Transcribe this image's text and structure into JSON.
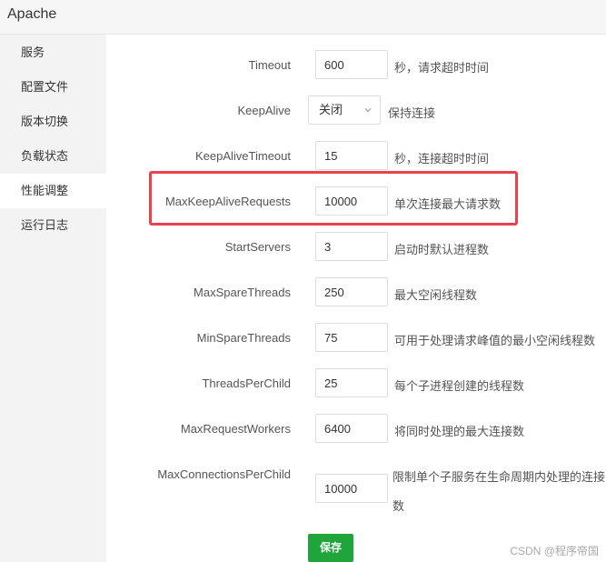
{
  "window": {
    "title": "Apache"
  },
  "sidebar": {
    "items": [
      {
        "label": "服务",
        "active": false
      },
      {
        "label": "配置文件",
        "active": false
      },
      {
        "label": "版本切换",
        "active": false
      },
      {
        "label": "负载状态",
        "active": false
      },
      {
        "label": "性能调整",
        "active": true
      },
      {
        "label": "运行日志",
        "active": false
      }
    ]
  },
  "settings": [
    {
      "label": "Timeout",
      "value": "600",
      "hint": "秒，请求超时时间"
    },
    {
      "label": "KeepAlive",
      "value": "关闭",
      "hint": "保持连接",
      "control": "select"
    },
    {
      "label": "KeepAliveTimeout",
      "value": "15",
      "hint": "秒，连接超时时间"
    },
    {
      "label": "MaxKeepAliveRequests",
      "value": "10000",
      "hint": "单次连接最大请求数",
      "highlighted": true
    },
    {
      "label": "StartServers",
      "value": "3",
      "hint": "启动时默认进程数"
    },
    {
      "label": "MaxSpareThreads",
      "value": "250",
      "hint": "最大空闲线程数"
    },
    {
      "label": "MinSpareThreads",
      "value": "75",
      "hint": "可用于处理请求峰值的最小空闲线程数"
    },
    {
      "label": "ThreadsPerChild",
      "value": "25",
      "hint": "每个子进程创建的线程数"
    },
    {
      "label": "MaxRequestWorkers",
      "value": "6400",
      "hint": "将同时处理的最大连接数"
    },
    {
      "label": "MaxConnectionsPerChild",
      "value": "10000",
      "hint_line1": "限制单个子服务在生命周期内处理的连接",
      "hint_line2": "数"
    }
  ],
  "actions": {
    "save_label": "保存"
  },
  "watermark": "CSDN @程序帝国",
  "colors": {
    "accent": "#20a53a",
    "highlight_border": "#e8424e"
  }
}
